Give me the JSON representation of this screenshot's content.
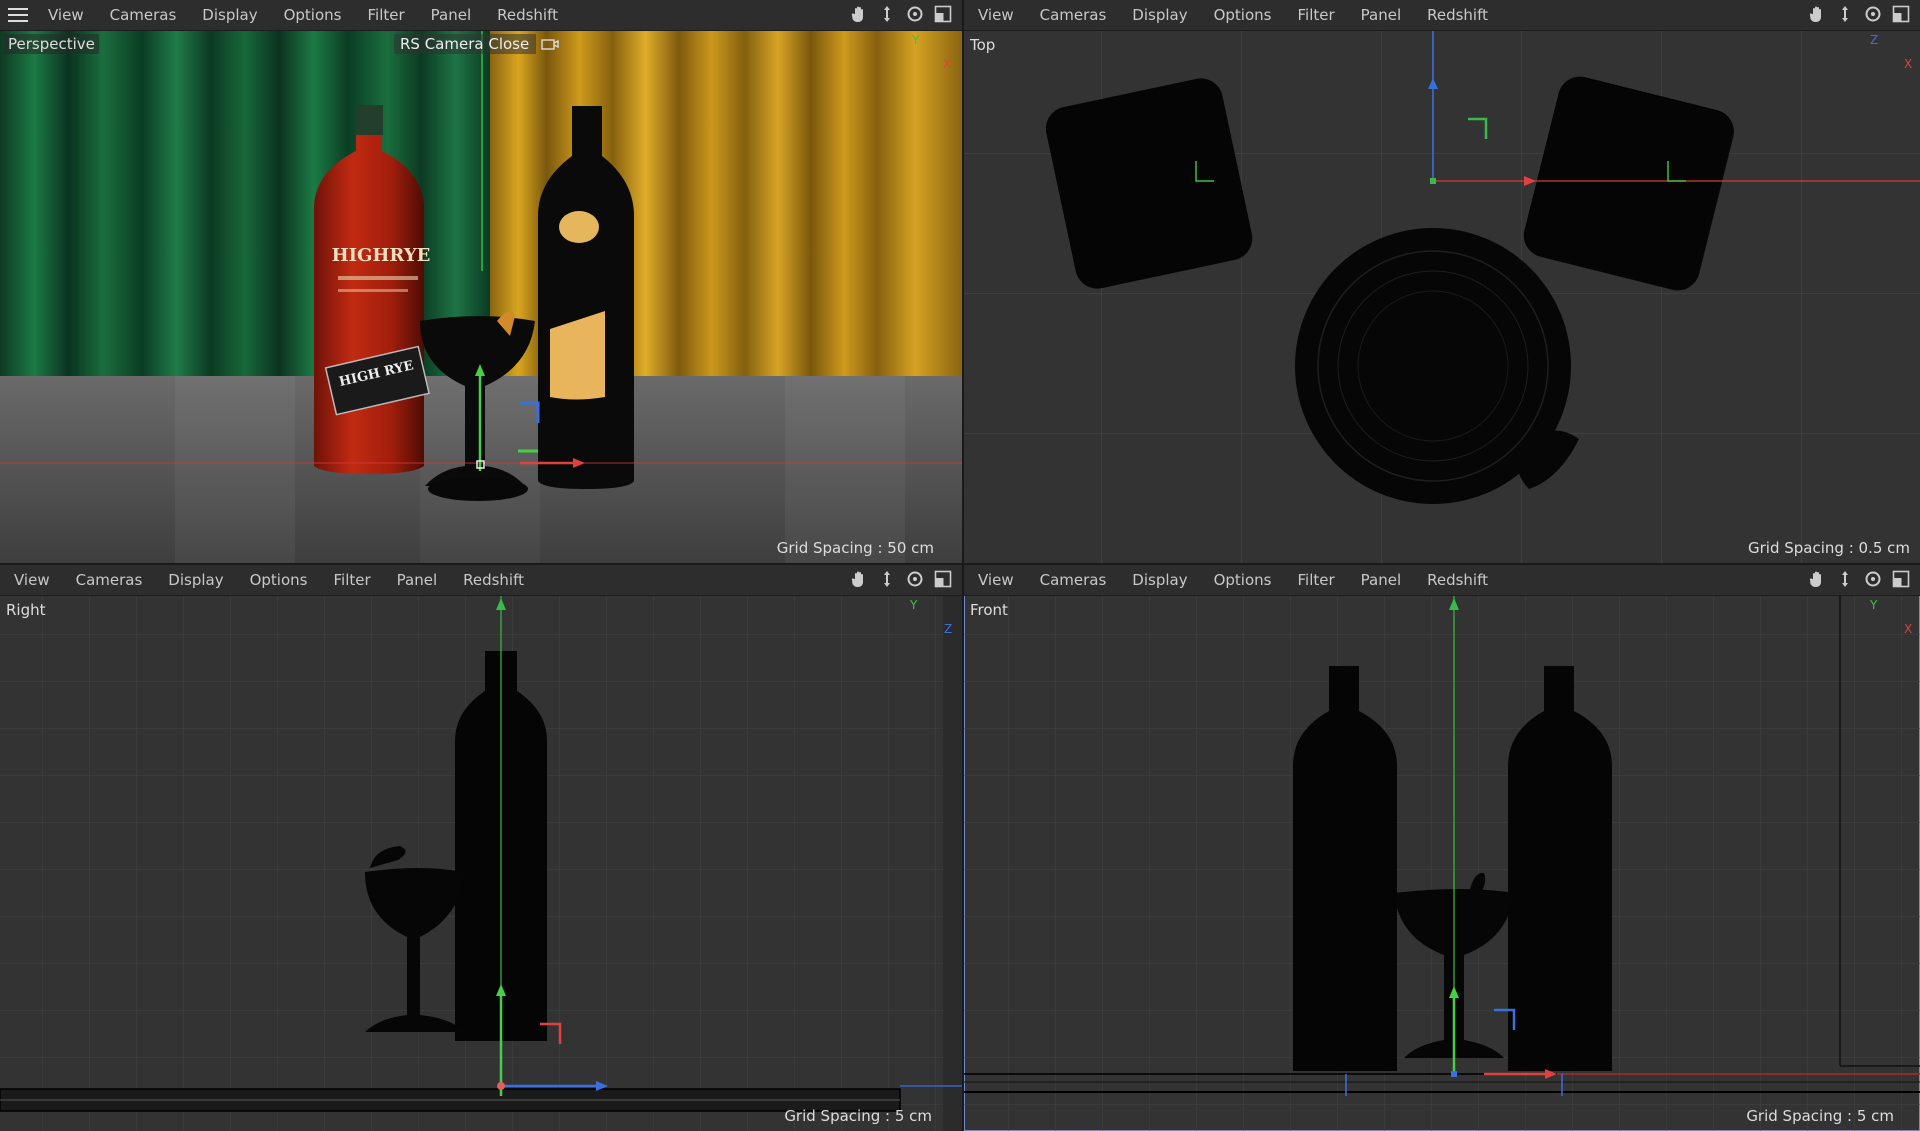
{
  "menu_items": [
    "View",
    "Cameras",
    "Display",
    "Options",
    "Filter",
    "Panel",
    "Redshift"
  ],
  "viewports": {
    "perspective": {
      "name": "Perspective",
      "camera": "RS Camera Close",
      "grid": "Grid Spacing : 50 cm",
      "axis1": "Y",
      "axis2": "X"
    },
    "top": {
      "name": "Top",
      "grid": "Grid Spacing : 0.5 cm",
      "axis1": "Z",
      "axis2": "X"
    },
    "right": {
      "name": "Right",
      "grid": "Grid Spacing : 5 cm",
      "axis1": "Y",
      "axis2": "Z"
    },
    "front": {
      "name": "Front",
      "grid": "Grid Spacing : 5 cm",
      "axis1": "Y",
      "axis2": "X"
    }
  },
  "label_text": {
    "brand": "HIGHRYE",
    "tag": "HIGH RYE"
  },
  "icons": [
    "hamburger-menu-icon",
    "pan-hand-icon",
    "move-arrows-icon",
    "rotate-icon",
    "maximize-view-icon",
    "camera-link-icon"
  ],
  "colors": {
    "accent": "#6f8ccf",
    "axis_x": "#e04040",
    "axis_y": "#40c040",
    "axis_z": "#3a6fe0"
  }
}
